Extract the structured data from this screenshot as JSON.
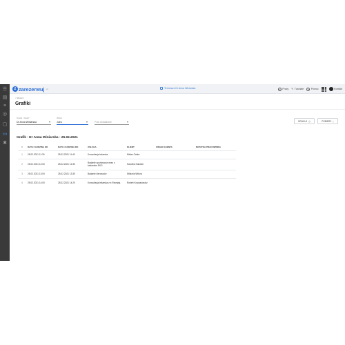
{
  "topbar": {
    "logo_text": "zarezerwuj",
    "logo_sub": ".pl",
    "center_link": "Terminarz Dr Anna Winiarska",
    "items": [
      {
        "label": "Pracy"
      },
      {
        "label": "Tutoriale"
      },
      {
        "label": "Pomoc"
      },
      {
        "label": "Kontakt"
      }
    ]
  },
  "breadcrumb": "< Wstecz",
  "page_title": "Grafiki",
  "filters": {
    "specialist": {
      "label": "Osoba / zasób *",
      "value": "Dr Anna Winiarska"
    },
    "view": {
      "label": "Widok",
      "value": "Jutro"
    },
    "extra": {
      "label": "",
      "value": "Pola dodatkowe"
    }
  },
  "buttons": {
    "print": "DRUKUJ",
    "download": "POBIERZ"
  },
  "section_title": "Grafik - Dr Anna Winiarska - 25.02.2021",
  "table": {
    "headers": [
      "#",
      "DATA I GODZINA OD",
      "DATA I GODZINA DO",
      "USŁUGA",
      "KLIENT",
      "UWAGI KLIENTA",
      "NOTATKA PRACOWNIKA"
    ],
    "rows": [
      {
        "n": "1",
        "from": "25.02.2021 11:30",
        "to": "25.02.2021 11:40",
        "service": "Konsultacja lekarska",
        "client": "Niklas Ćwika",
        "notes": "",
        "staff": ""
      },
      {
        "n": "2",
        "from": "25.02.2021 12:00",
        "to": "25.02.2021 12:30",
        "service": "Badanie sportowców wraz z badaniem EKG",
        "client": "Karolina Kołusek",
        "notes": "",
        "staff": ""
      },
      {
        "n": "3",
        "from": "25.02.2021 13:00",
        "to": "25.02.2021 13:30",
        "service": "Badanie kierowców",
        "client": "Wiktoria Witura",
        "notes": "",
        "staff": ""
      },
      {
        "n": "4",
        "from": "25.02.2021 14:00",
        "to": "25.02.2021 14:20",
        "service": "Konsultacja lekarska z e-Receptą",
        "client": "Robert Krzyżakowicz",
        "notes": "",
        "staff": ""
      }
    ]
  },
  "colors": {
    "accent": "#2f6fd6",
    "sidebar": "#3a3a3a"
  }
}
